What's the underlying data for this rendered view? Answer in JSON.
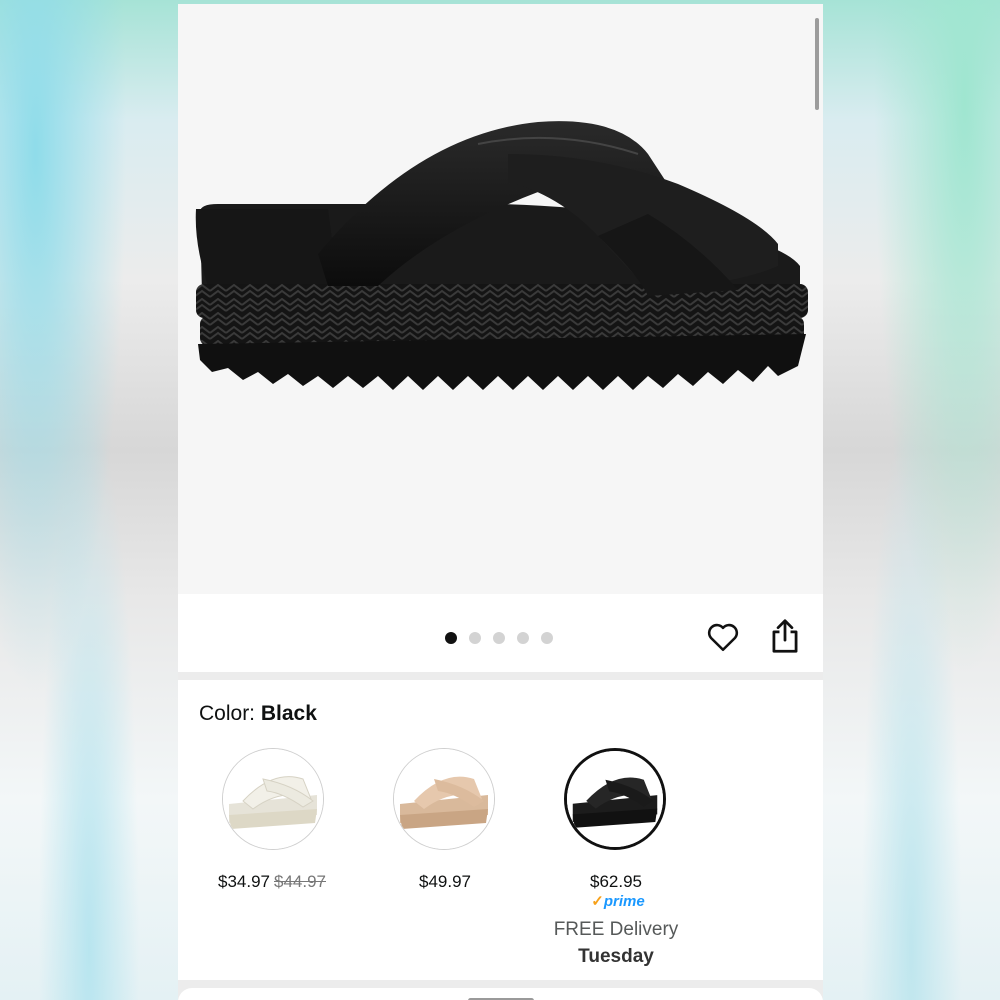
{
  "product_image": {
    "icon": "black-crossband-platform-sandal",
    "page_count": 5,
    "active_index": 0
  },
  "actions": {
    "wishlist_icon": "heart-icon",
    "share_icon": "share-icon"
  },
  "color": {
    "label": "Color:",
    "selected": "Black"
  },
  "swatches": [
    {
      "name": "white-sandal",
      "price": "$34.97",
      "list_price": "$44.97",
      "color": "#f1efe6"
    },
    {
      "name": "nude-sandal",
      "price": "$49.97",
      "color": "#e2c3a8"
    },
    {
      "name": "black-sandal",
      "price": "$62.95",
      "color": "#111111",
      "prime": "prime",
      "delivery_line1": "FREE Delivery",
      "delivery_line2": "Tuesday"
    }
  ],
  "colors": {
    "prime_blue": "#1a98ff",
    "prime_check": "#f7a11a"
  }
}
